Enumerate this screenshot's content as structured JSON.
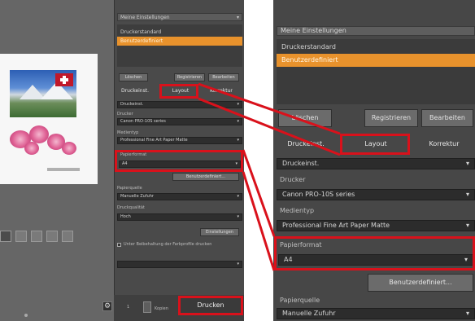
{
  "left_panel": {
    "preset_select": "Meine Einstellungen",
    "preset_items": [
      "Druckerstandard",
      "Benutzerdefiniert"
    ],
    "selected_index": 1,
    "buttons": {
      "delete": "Löschen",
      "register": "Registrieren",
      "edit": "Bearbeiten"
    },
    "tabs": [
      "Druckeinst.",
      "Layout",
      "Korrektur"
    ],
    "fields": [
      {
        "label": "",
        "value": "Druckeinst."
      },
      {
        "label": "Drucker",
        "value": "Canon PRO-10S series"
      },
      {
        "label": "Medientyp",
        "value": "Professional Fine Art Paper Matte"
      },
      {
        "label": "Papierformat",
        "value": "A4"
      }
    ],
    "custom_button": "Benutzerdefiniert...",
    "source_label": "Papierquelle",
    "source_value": "Manuelle Zufuhr",
    "quality_label": "Druckqualität",
    "quality_value": "Hoch",
    "quality_button": "Einstellungen",
    "checkbox_label": "Unter Beibehaltung der Farbprofile drucken",
    "print_button": "Drucken",
    "gear_icon": "⚙",
    "counter": "1",
    "page_label": "Kopien"
  },
  "zoomed_panel": {
    "preset_select": "Meine Einstellungen",
    "preset_items": [
      "Druckerstandard",
      "Benutzerdefiniert"
    ],
    "selected_index": 1,
    "buttons": {
      "delete": "Löschen",
      "register": "Registrieren",
      "edit": "Bearbeiten"
    },
    "tabs": [
      "Druckeinst.",
      "Layout",
      "Korrektur"
    ],
    "settings_value": "Druckeinst.",
    "printer_label": "Drucker",
    "printer_value": "Canon PRO-10S series",
    "media_label": "Medientyp",
    "media_value": "Professional Fine Art Paper Matte",
    "paper_label": "Papierformat",
    "paper_value": "A4",
    "custom_button": "Benutzerdefiniert...",
    "source_label": "Papierquelle",
    "source_value": "Manuelle Zufuhr"
  },
  "highlight_color": "#d9111b",
  "accent_color": "#e8922c"
}
